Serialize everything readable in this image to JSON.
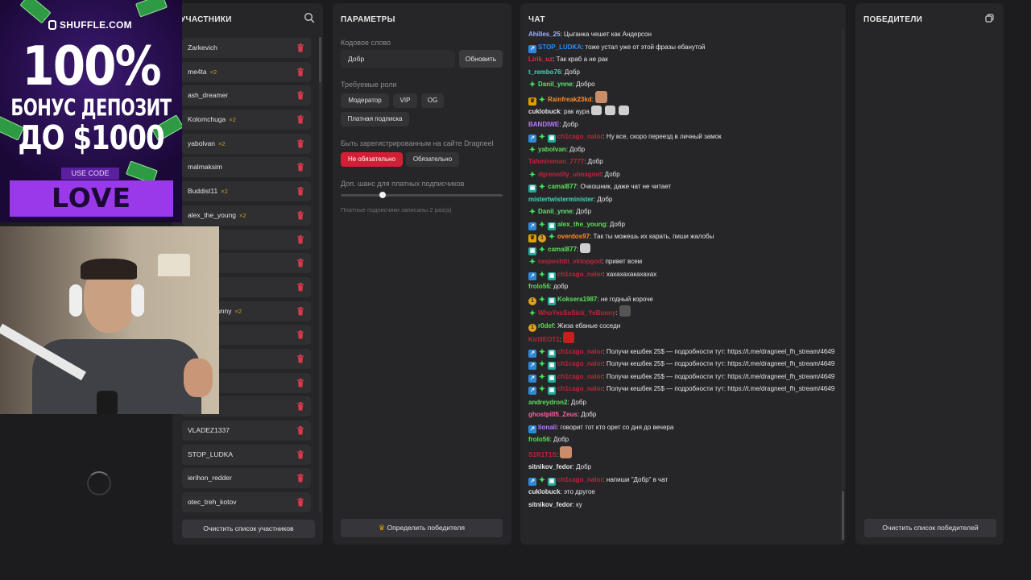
{
  "participants": {
    "title": "УЧАСТНИКИ",
    "items": [
      {
        "name": "Zarkevich",
        "mult": ""
      },
      {
        "name": "me4ta",
        "mult": "×2"
      },
      {
        "name": "ash_dreamer",
        "mult": ""
      },
      {
        "name": "Kolomchuga",
        "mult": "×2"
      },
      {
        "name": "yabolvan",
        "mult": "×2"
      },
      {
        "name": "malmaksim",
        "mult": ""
      },
      {
        "name": "Buddist11",
        "mult": "×2"
      },
      {
        "name": "alex_the_young",
        "mult": "×2"
      },
      {
        "name": "ie",
        "mult": ""
      },
      {
        "name": "",
        "mult": ""
      },
      {
        "name": "e",
        "mult": ""
      },
      {
        "name": "Sick_YeBunny",
        "mult": "×2"
      },
      {
        "name": "",
        "mult": ""
      },
      {
        "name": "",
        "mult": ""
      },
      {
        "name": "",
        "mult": ""
      },
      {
        "name": "",
        "mult": "×2"
      },
      {
        "name": "VLADEZ1337",
        "mult": ""
      },
      {
        "name": "STOP_LUDKA",
        "mult": ""
      },
      {
        "name": "ierihon_redder",
        "mult": ""
      },
      {
        "name": "otec_treh_kotov",
        "mult": ""
      }
    ],
    "clear_label": "Очистить список участников"
  },
  "params": {
    "title": "ПАРАМЕТРЫ",
    "keyword_label": "Кодовое слово",
    "keyword_value": "Добр",
    "update_label": "Обновить",
    "roles_label": "Требуемые роли",
    "roles": [
      "Модератор",
      "VIP",
      "OG",
      "Платная подписка"
    ],
    "registered_label": "Быть зарегистрированным на сайте Dragneel",
    "reg_options": [
      "Не обязательно",
      "Обязательно"
    ],
    "chance_label": "Доп. шанс для платных подписчиков",
    "chance_value": 0.26,
    "chance_hint": "Платные подписчики записаны 2 раз(а)",
    "pick_label": "Определить победителя"
  },
  "chat": {
    "title": "ЧАТ",
    "messages": [
      {
        "badges": [],
        "user": "Ahilles_25",
        "color": "#9fb3ff",
        "text": ": Цыганка чешет как Андерсон"
      },
      {
        "badges": [
          "blue"
        ],
        "user": "STOP_LUDKA",
        "color": "#1e90ff",
        "text": ": тоже устал уже от этой фразы ебанутой"
      },
      {
        "badges": [],
        "user": "Lirik_uz",
        "color": "#d9304d",
        "text": ": Так краб а не рак"
      },
      {
        "badges": [],
        "user": "t_rembo76",
        "color": "#3fd9b8",
        "text": ": Добр"
      },
      {
        "badges": [
          "green"
        ],
        "user": "Danil_ynne",
        "color": "#54e872",
        "text": ": Добро"
      },
      {
        "badges": [
          "crown",
          "green"
        ],
        "user": "Rainfreak23kd",
        "color": "#ff8c28",
        "text": ":",
        "emote": "pic"
      },
      {
        "badges": [],
        "user": "cuklobuck",
        "color": "#e8e8e8",
        "text": ": рак аура",
        "emote": "skulls"
      },
      {
        "badges": [],
        "user": "BANDIWE",
        "color": "#b67cff",
        "text": ": Добр"
      },
      {
        "badges": [
          "blue",
          "green",
          "gift"
        ],
        "user": "ch1cago_nalor",
        "color": "#c0243a",
        "text": ": Ну все, скоро переезд в личный замок"
      },
      {
        "badges": [
          "green"
        ],
        "user": "yabolvan",
        "color": "#5ce05a",
        "text": ": Добр"
      },
      {
        "badges": [],
        "user": "Tahmireman_7777",
        "color": "#c0243a",
        "text": ": Добр"
      },
      {
        "badges": [
          "green"
        ],
        "user": "dgrenotily_ulmagnel",
        "color": "#c0243a",
        "text": ": Добр"
      },
      {
        "badges": [
          "gift",
          "green"
        ],
        "user": "camal877",
        "color": "#5ce05a",
        "text": ": Очкошник, даже чат не читает"
      },
      {
        "badges": [],
        "user": "mistertwisterminister",
        "color": "#3fd9b8",
        "text": ": Добр"
      },
      {
        "badges": [
          "green"
        ],
        "user": "Danil_ynne",
        "color": "#54e872",
        "text": ": Добр"
      },
      {
        "badges": [
          "blue",
          "green",
          "gift"
        ],
        "user": "alex_the_young",
        "color": "#5ce05a",
        "text": ": Добр"
      },
      {
        "badges": [
          "crown",
          "coin",
          "green"
        ],
        "user": "overdos97",
        "color": "#ff8c28",
        "text": ": Так ты можешь их карать, пиши жалобы"
      },
      {
        "badges": [
          "gift",
          "green"
        ],
        "user": "camal877",
        "color": "#5ce05a",
        "text": ":",
        "emote": "skull"
      },
      {
        "badges": [
          "green"
        ],
        "user": "rasposhtti_vktopgod",
        "color": "#c0243a",
        "text": ": привет всем"
      },
      {
        "badges": [
          "blue",
          "green",
          "gift"
        ],
        "user": "ch1cago_nalor",
        "color": "#c0243a",
        "text": ": хахахахакахахах"
      },
      {
        "badges": [],
        "user": "frolo56",
        "color": "#5ce05a",
        "text": ": добр"
      },
      {
        "badges": [
          "coin",
          "green",
          "gift"
        ],
        "user": "Koksera1987",
        "color": "#5ce05a",
        "text": ": не годный короче"
      },
      {
        "badges": [
          "green"
        ],
        "user": "WhoYesSoSick_YeBunny",
        "color": "#c0243a",
        "text": ":",
        "emote": "dark"
      },
      {
        "badges": [
          "coin"
        ],
        "user": "r0def",
        "color": "#5ce05a",
        "text": ": Жиза ебаные соседи"
      },
      {
        "badges": [],
        "user": "KirillEOT1",
        "color": "#c0243a",
        "text": ":",
        "emote": "red"
      },
      {
        "badges": [
          "blue",
          "green",
          "gift"
        ],
        "user": "ch1cago_nalor",
        "color": "#c0243a",
        "text": ": Получи кешбек 25$ — подробности тут: https://t.me/dragneel_fh_stream/4649",
        "wrap": true
      },
      {
        "badges": [
          "blue",
          "green",
          "gift"
        ],
        "user": "ch1cago_nalor",
        "color": "#c0243a",
        "text": ": Получи кешбек 25$ — подробности тут: https://t.me/dragneel_fh_stream/4649",
        "wrap": true
      },
      {
        "badges": [
          "blue",
          "green",
          "gift"
        ],
        "user": "ch1cago_nalor",
        "color": "#c0243a",
        "text": ": Получи кешбек 25$ — подробности тут: https://t.me/dragneel_fh_stream/4649",
        "wrap": true
      },
      {
        "badges": [
          "blue",
          "green",
          "gift"
        ],
        "user": "ch1cago_nalor",
        "color": "#c0243a",
        "text": ": Получи кешбек 25$ — подробности тут: https://t.me/dragneel_fh_stream/4649",
        "wrap": true
      },
      {
        "badges": [],
        "user": "andreydron2",
        "color": "#5ce05a",
        "text": ": Добр"
      },
      {
        "badges": [],
        "user": "ghostpill5_Zeus",
        "color": "#ff5fa2",
        "text": ": Добр"
      },
      {
        "badges": [
          "blue"
        ],
        "user": "lionali",
        "color": "#b67cff",
        "text": ": говорит тот кто орет со дня до вечера"
      },
      {
        "badges": [],
        "user": "frolo56",
        "color": "#5ce05a",
        "text": ": Добр"
      },
      {
        "badges": [],
        "user": "S1R1T1S",
        "color": "#c0243a",
        "text": ":",
        "emote": "pic"
      },
      {
        "badges": [],
        "user": "sitnikov_fedor",
        "color": "#e8e8e8",
        "text": ": Добр"
      },
      {
        "badges": [
          "blue",
          "green",
          "gift"
        ],
        "user": "ch1cago_nalor",
        "color": "#c0243a",
        "text": ": напиши \"Добр\" в чат"
      },
      {
        "badges": [],
        "user": "cuklobuck",
        "color": "#e8e8e8",
        "text": ": это другое"
      },
      {
        "badges": [],
        "user": "sitnikov_fedor",
        "color": "#e8e8e8",
        "text": ": ку"
      }
    ]
  },
  "winners": {
    "title": "ПОБЕДИТЕЛИ",
    "clear_label": "Очистить список победителей"
  },
  "promo": {
    "brand": "SHUFFLE.COM",
    "headline": "100%",
    "line2": "БОНУС ДЕПОЗИТ",
    "line3": "ДО $1000",
    "code_tag": "USE CODE",
    "code": "LOVE"
  }
}
